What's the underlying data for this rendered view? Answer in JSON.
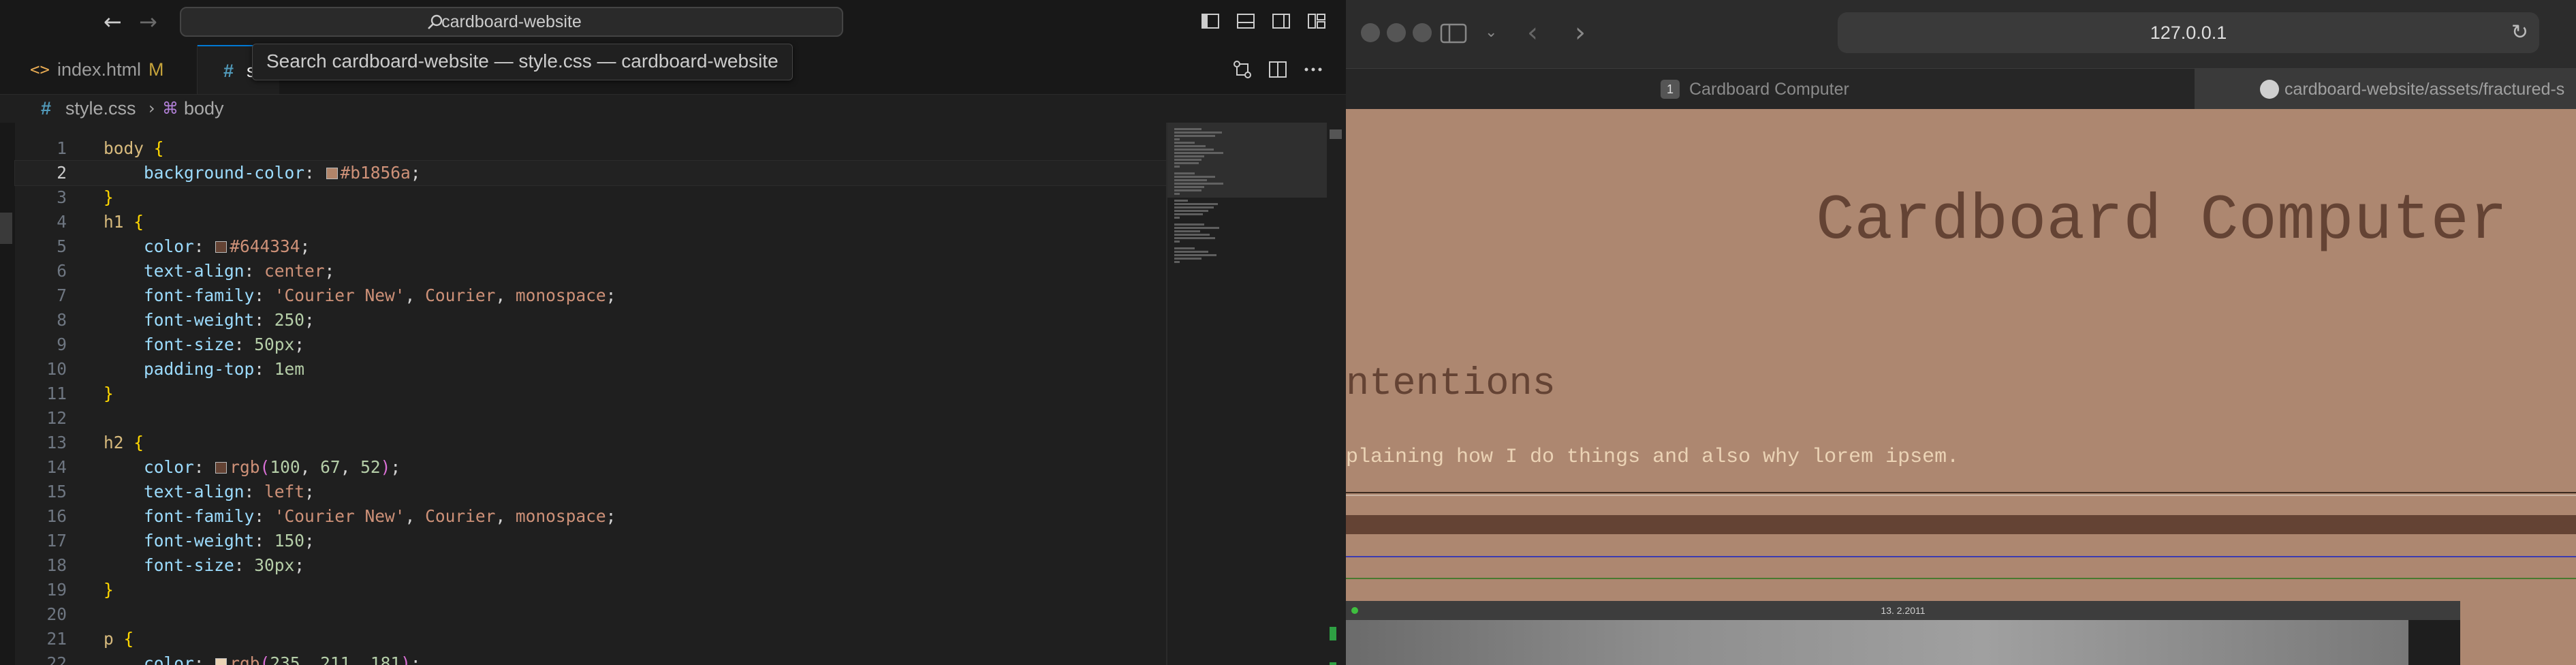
{
  "vscode": {
    "command_center": "cardboard-website",
    "tabs": [
      {
        "label": "index.html",
        "status": "M",
        "icon": "html-file-icon"
      },
      {
        "label": "s",
        "icon": "css-file-icon"
      }
    ],
    "tooltip": "Search cardboard-website — style.css — cardboard-website",
    "breadcrumb": {
      "file": "style.css",
      "separator": "›",
      "symbol": "body"
    },
    "lines": [
      {
        "n": "1",
        "tokens": [
          [
            "sel",
            "body "
          ],
          [
            "brace",
            "{"
          ]
        ]
      },
      {
        "n": "2",
        "current": true,
        "tokens": [
          [
            "prop",
            "    background-color"
          ],
          [
            "punc",
            ": "
          ],
          [
            "swatch",
            "#b1856a"
          ],
          [
            "val",
            "#b1856a"
          ],
          [
            "punc",
            ";"
          ]
        ]
      },
      {
        "n": "3",
        "tokens": [
          [
            "brace",
            "}"
          ]
        ]
      },
      {
        "n": "4",
        "tokens": [
          [
            "sel",
            "h1 "
          ],
          [
            "brace",
            "{"
          ]
        ]
      },
      {
        "n": "5",
        "tokens": [
          [
            "prop",
            "    color"
          ],
          [
            "punc",
            ": "
          ],
          [
            "swatch",
            "#644334"
          ],
          [
            "val",
            "#644334"
          ],
          [
            "punc",
            ";"
          ]
        ]
      },
      {
        "n": "6",
        "tokens": [
          [
            "prop",
            "    text-align"
          ],
          [
            "punc",
            ": "
          ],
          [
            "val",
            "center"
          ],
          [
            "punc",
            ";"
          ]
        ]
      },
      {
        "n": "7",
        "tokens": [
          [
            "prop",
            "    font-family"
          ],
          [
            "punc",
            ": "
          ],
          [
            "val",
            "'Courier New'"
          ],
          [
            "punc",
            ", "
          ],
          [
            "val",
            "Courier"
          ],
          [
            "punc",
            ", "
          ],
          [
            "val",
            "monospace"
          ],
          [
            "punc",
            ";"
          ]
        ]
      },
      {
        "n": "8",
        "tokens": [
          [
            "prop",
            "    font-weight"
          ],
          [
            "punc",
            ": "
          ],
          [
            "num",
            "250"
          ],
          [
            "punc",
            ";"
          ]
        ]
      },
      {
        "n": "9",
        "tokens": [
          [
            "prop",
            "    font-size"
          ],
          [
            "punc",
            ": "
          ],
          [
            "num",
            "50px"
          ],
          [
            "punc",
            ";"
          ]
        ]
      },
      {
        "n": "10",
        "tokens": [
          [
            "prop",
            "    padding-top"
          ],
          [
            "punc",
            ": "
          ],
          [
            "num",
            "1em"
          ]
        ]
      },
      {
        "n": "11",
        "tokens": [
          [
            "brace",
            "}"
          ]
        ]
      },
      {
        "n": "12",
        "tokens": []
      },
      {
        "n": "13",
        "tokens": [
          [
            "sel",
            "h2 "
          ],
          [
            "brace",
            "{"
          ]
        ]
      },
      {
        "n": "14",
        "tokens": [
          [
            "prop",
            "    color"
          ],
          [
            "punc",
            ": "
          ],
          [
            "swatch",
            "rgb(100, 67, 52)"
          ],
          [
            "val",
            "rgb"
          ],
          [
            "brace2",
            "("
          ],
          [
            "num",
            "100"
          ],
          [
            "punc",
            ", "
          ],
          [
            "num",
            "67"
          ],
          [
            "punc",
            ", "
          ],
          [
            "num",
            "52"
          ],
          [
            "brace2",
            ")"
          ],
          [
            "punc",
            ";"
          ]
        ]
      },
      {
        "n": "15",
        "tokens": [
          [
            "prop",
            "    text-align"
          ],
          [
            "punc",
            ": "
          ],
          [
            "val",
            "left"
          ],
          [
            "punc",
            ";"
          ]
        ]
      },
      {
        "n": "16",
        "tokens": [
          [
            "prop",
            "    font-family"
          ],
          [
            "punc",
            ": "
          ],
          [
            "val",
            "'Courier New'"
          ],
          [
            "punc",
            ", "
          ],
          [
            "val",
            "Courier"
          ],
          [
            "punc",
            ", "
          ],
          [
            "val",
            "monospace"
          ],
          [
            "punc",
            ";"
          ]
        ]
      },
      {
        "n": "17",
        "tokens": [
          [
            "prop",
            "    font-weight"
          ],
          [
            "punc",
            ": "
          ],
          [
            "num",
            "150"
          ],
          [
            "punc",
            ";"
          ]
        ]
      },
      {
        "n": "18",
        "tokens": [
          [
            "prop",
            "    font-size"
          ],
          [
            "punc",
            ": "
          ],
          [
            "num",
            "30px"
          ],
          [
            "punc",
            ";"
          ]
        ]
      },
      {
        "n": "19",
        "tokens": [
          [
            "brace",
            "}"
          ]
        ]
      },
      {
        "n": "20",
        "tokens": []
      },
      {
        "n": "21",
        "tokens": [
          [
            "sel",
            "p "
          ],
          [
            "brace",
            "{"
          ]
        ]
      },
      {
        "n": "22",
        "tokens": [
          [
            "prop",
            "    color"
          ],
          [
            "punc",
            ": "
          ],
          [
            "swatch",
            "rgb(235, 211, 181)"
          ],
          [
            "val",
            "rgb"
          ],
          [
            "brace2",
            "("
          ],
          [
            "num",
            "235"
          ],
          [
            "punc",
            ", "
          ],
          [
            "num",
            "211"
          ],
          [
            "punc",
            ", "
          ],
          [
            "num",
            "181"
          ],
          [
            "brace2",
            ")"
          ],
          [
            "punc",
            ";"
          ]
        ]
      }
    ]
  },
  "safari": {
    "url": "127.0.0.1",
    "tabs": [
      {
        "label": "Cardboard Computer",
        "favicon": "1"
      },
      {
        "label": "cardboard-website/assets/fractured-s",
        "favicon": "github-icon"
      }
    ],
    "page": {
      "h1": "Cardboard Computer",
      "h2": "ntentions",
      "p": "plaining how I do things and also why lorem ipsem.",
      "photo_date": "13. 2.2011"
    }
  },
  "colors": {
    "page_background": "#ad8770",
    "heading": "#644334",
    "paragraph": "#ebd3b5",
    "accent": "#0078d4"
  }
}
